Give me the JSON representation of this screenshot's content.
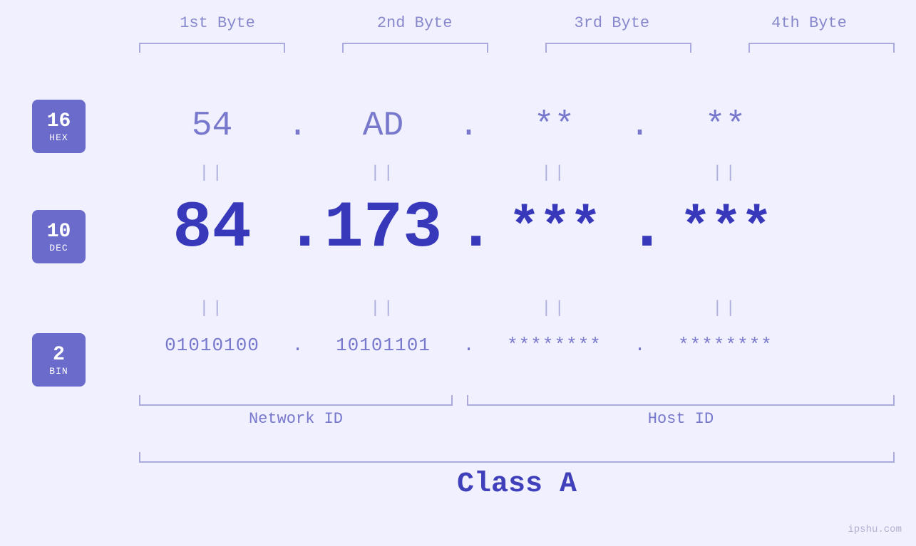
{
  "page": {
    "background": "#f0f0ff",
    "watermark": "ipshu.com"
  },
  "byte_labels": [
    "1st Byte",
    "2nd Byte",
    "3rd Byte",
    "4th Byte"
  ],
  "badges": [
    {
      "number": "16",
      "label": "HEX"
    },
    {
      "number": "10",
      "label": "DEC"
    },
    {
      "number": "2",
      "label": "BIN"
    }
  ],
  "hex_row": {
    "values": [
      "54",
      "AD",
      "**",
      "**"
    ],
    "dots": [
      ".",
      ".",
      ".",
      ""
    ]
  },
  "dec_row": {
    "values": [
      "84",
      "173",
      "***",
      "***"
    ],
    "dots": [
      ".",
      ".",
      ".",
      ""
    ]
  },
  "bin_row": {
    "values": [
      "01010100",
      "10101101",
      "********",
      "********"
    ],
    "dots": [
      ".",
      ".",
      ".",
      ""
    ]
  },
  "labels": {
    "network_id": "Network ID",
    "host_id": "Host ID",
    "class": "Class A"
  }
}
